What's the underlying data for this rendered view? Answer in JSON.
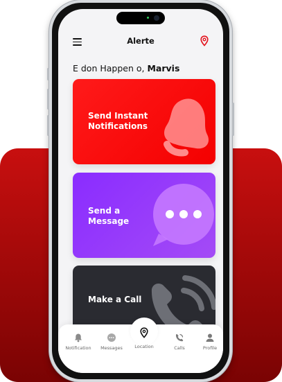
{
  "app": {
    "title": "Alerte"
  },
  "greeting": {
    "prefix": "E don Happen o, ",
    "name": "Marvis"
  },
  "cards": [
    {
      "label": "Send Instant Notifications",
      "icon": "bell-icon",
      "color": "#ff0f0f"
    },
    {
      "label": "Send a Message",
      "icon": "chat-bubble-icon",
      "color": "#9333ff"
    },
    {
      "label": "Make a Call",
      "icon": "phone-icon",
      "color": "#2a2b31"
    }
  ],
  "nav": [
    {
      "label": "Notification",
      "icon": "bell-icon"
    },
    {
      "label": "Messages",
      "icon": "chat-icon"
    },
    {
      "label": "Location",
      "icon": "location-pin-icon"
    },
    {
      "label": "Calls",
      "icon": "phone-icon"
    },
    {
      "label": "Profile",
      "icon": "user-icon"
    }
  ],
  "colors": {
    "accent": "#ff0f0f",
    "backdrop": "#b30909"
  }
}
